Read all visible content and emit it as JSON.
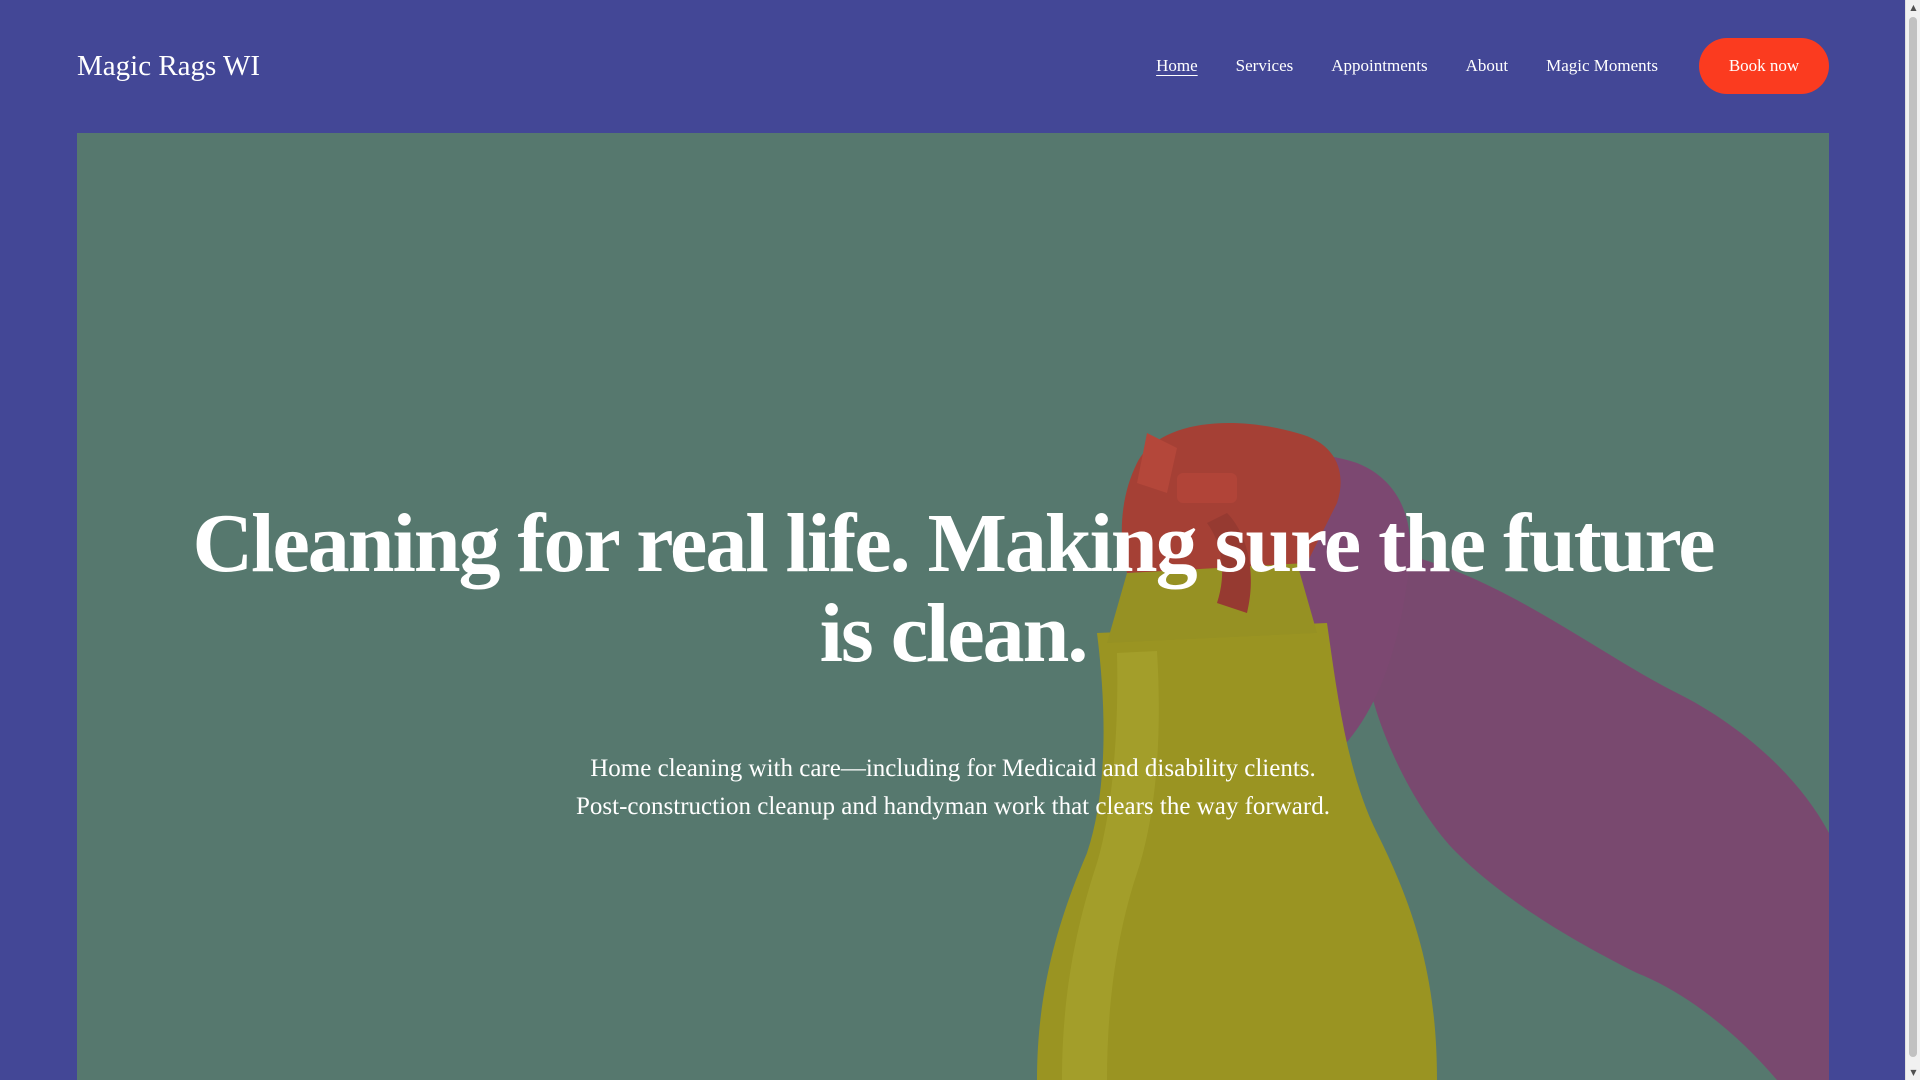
{
  "header": {
    "site_title": "Magic Rags WI",
    "nav": [
      {
        "label": "Home",
        "active": true
      },
      {
        "label": "Services",
        "active": false
      },
      {
        "label": "Appointments",
        "active": false
      },
      {
        "label": "About",
        "active": false
      },
      {
        "label": "Magic Moments",
        "active": false
      }
    ],
    "cta_label": "Book now"
  },
  "hero": {
    "title": "Cleaning for real life. Making sure the future is clean.",
    "subtitle_line1": "Home cleaning with care—including for Medicaid and disability clients.",
    "subtitle_line2": "Post-construction cleanup and handyman work that clears the way forward.",
    "image_description_icon": "spray-bottle-glove-image"
  },
  "colors": {
    "background": "#434796",
    "cta": "#fb3b1f",
    "hero_tint": "#5a7a72",
    "glove": "#8e3a78",
    "bottle": "#c9b400",
    "trigger": "#d8302a"
  }
}
